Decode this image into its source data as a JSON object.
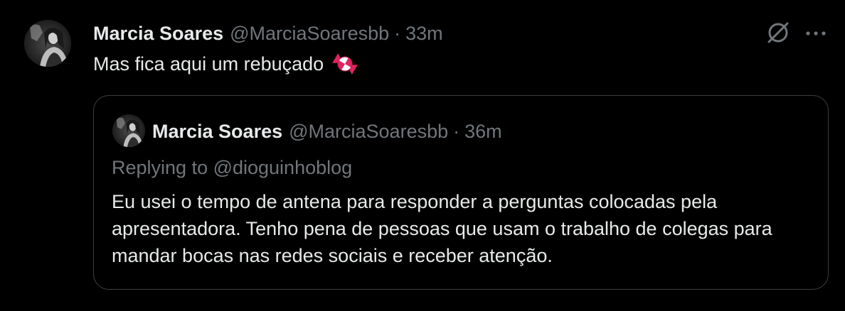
{
  "tweet": {
    "author_name": "Marcia Soares",
    "author_handle": "@MarciaSoaresbb",
    "separator": "·",
    "time": "33m",
    "text": "Mas fica aqui um rebuçado",
    "emoji_icon": "candy-icon",
    "actions": {
      "grok_icon": "grok-icon",
      "more_icon": "more-icon"
    }
  },
  "quoted_tweet": {
    "author_name": "Marcia Soares",
    "author_handle": "@MarciaSoaresbb",
    "separator": "·",
    "time": "36m",
    "replying_to": "Replying to @dioguinhoblog",
    "text": "Eu usei o tempo de antena para responder a perguntas colocadas pela apresentadora. Tenho pena de pessoas que usam o trabalho de colegas para mandar bocas nas redes sociais e receber atenção."
  },
  "colors": {
    "background": "#000000",
    "primary_text": "#e7e9ea",
    "secondary_text": "#71767b",
    "border": "#3c3f44",
    "candy_red": "#e0245e"
  }
}
